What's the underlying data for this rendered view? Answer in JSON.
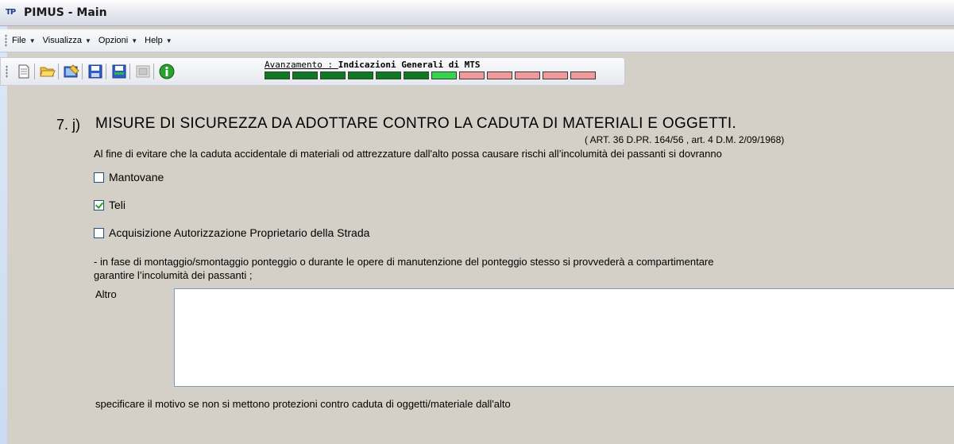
{
  "window": {
    "app_icon_text": "TP",
    "title": "PIMUS - Main"
  },
  "menu": {
    "items": [
      {
        "label": "File"
      },
      {
        "label": "Visualizza"
      },
      {
        "label": "Opzioni"
      },
      {
        "label": "Help"
      }
    ]
  },
  "toolbar": {
    "buttons": [
      "new-document-icon",
      "open-folder-icon",
      "edit-image-icon",
      "save-icon",
      "save-as-icon",
      "disabled-image-icon",
      "info-icon"
    ],
    "progress": {
      "label_prefix": "Avanzamento : ",
      "label_value": "Indicazioni Generali di MTS",
      "steps": [
        "done",
        "done",
        "done",
        "done",
        "done",
        "done",
        "current",
        "todo",
        "todo",
        "todo",
        "todo",
        "todo"
      ],
      "colors": {
        "done": "#0c7a21",
        "current": "#33d64b",
        "todo": "#f29a9a"
      }
    }
  },
  "section": {
    "number": "7. j)",
    "title": "MISURE DI SICUREZZA DA ADOTTARE CONTRO LA CADUTA DI MATERIALI E OGGETTI.",
    "reference": "( ART. 36 D.PR. 164/56 , art. 4 D.M. 2/09/1968)",
    "intro": "Al fine di evitare che la caduta accidentale di materiali od attrezzature dall'alto possa causare rischi all’incolumità dei passanti si dovranno",
    "options": [
      {
        "label": "Mantovane",
        "checked": false
      },
      {
        "label": "Teli",
        "checked": true
      },
      {
        "label": "Acquisizione Autorizzazione Proprietario della Strada",
        "checked": false
      }
    ],
    "note_line1": "- in fase di montaggio/smontaggio ponteggio o durante le opere di manutenzione del ponteggio stesso si provvederà a compartimentare",
    "note_line2": "garantire l’incolumità dei passanti ;",
    "altro_label": "Altro",
    "altro_value": "",
    "footer": "specificare il motivo se non si mettono protezioni contro caduta di oggetti/materiale dall'alto"
  }
}
